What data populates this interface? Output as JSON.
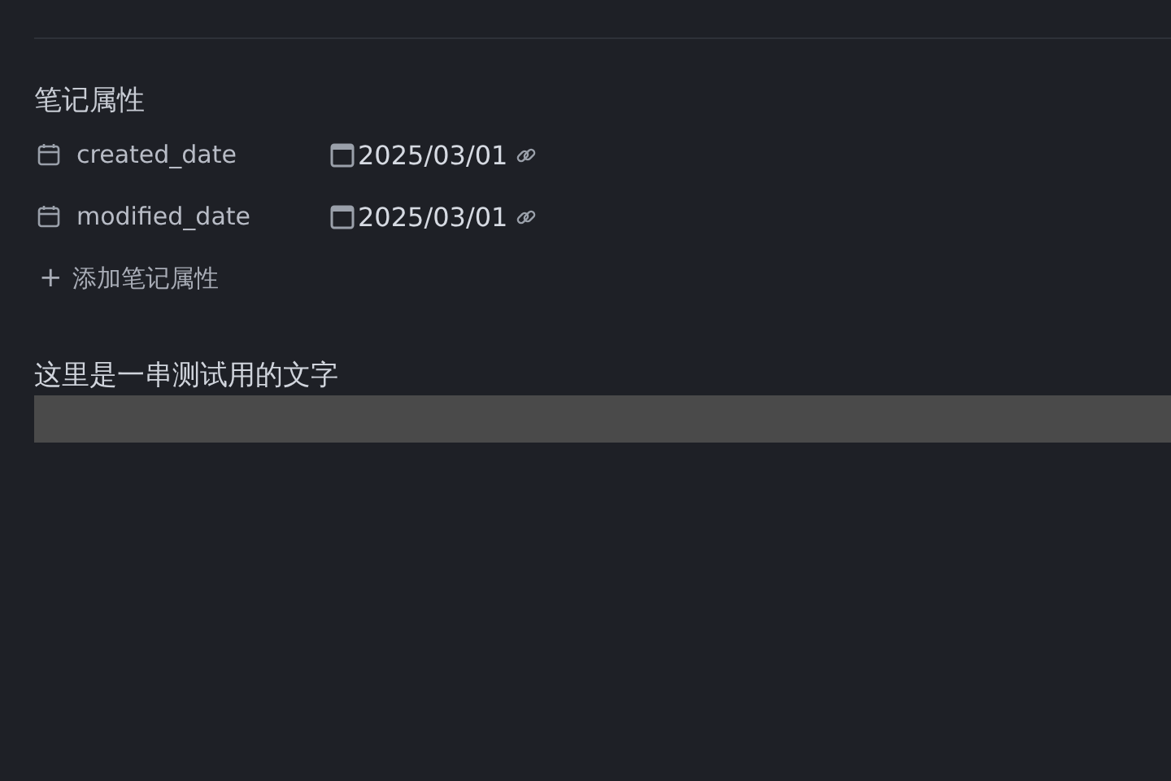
{
  "properties": {
    "heading": "笔记属性",
    "items": [
      {
        "name": "created_date",
        "value": "2025/03/01"
      },
      {
        "name": "modified_date",
        "value": "2025/03/01"
      }
    ],
    "add_label": "添加笔记属性",
    "add_icon": "+"
  },
  "body": {
    "paragraph": "这里是一串测试用的文字"
  }
}
